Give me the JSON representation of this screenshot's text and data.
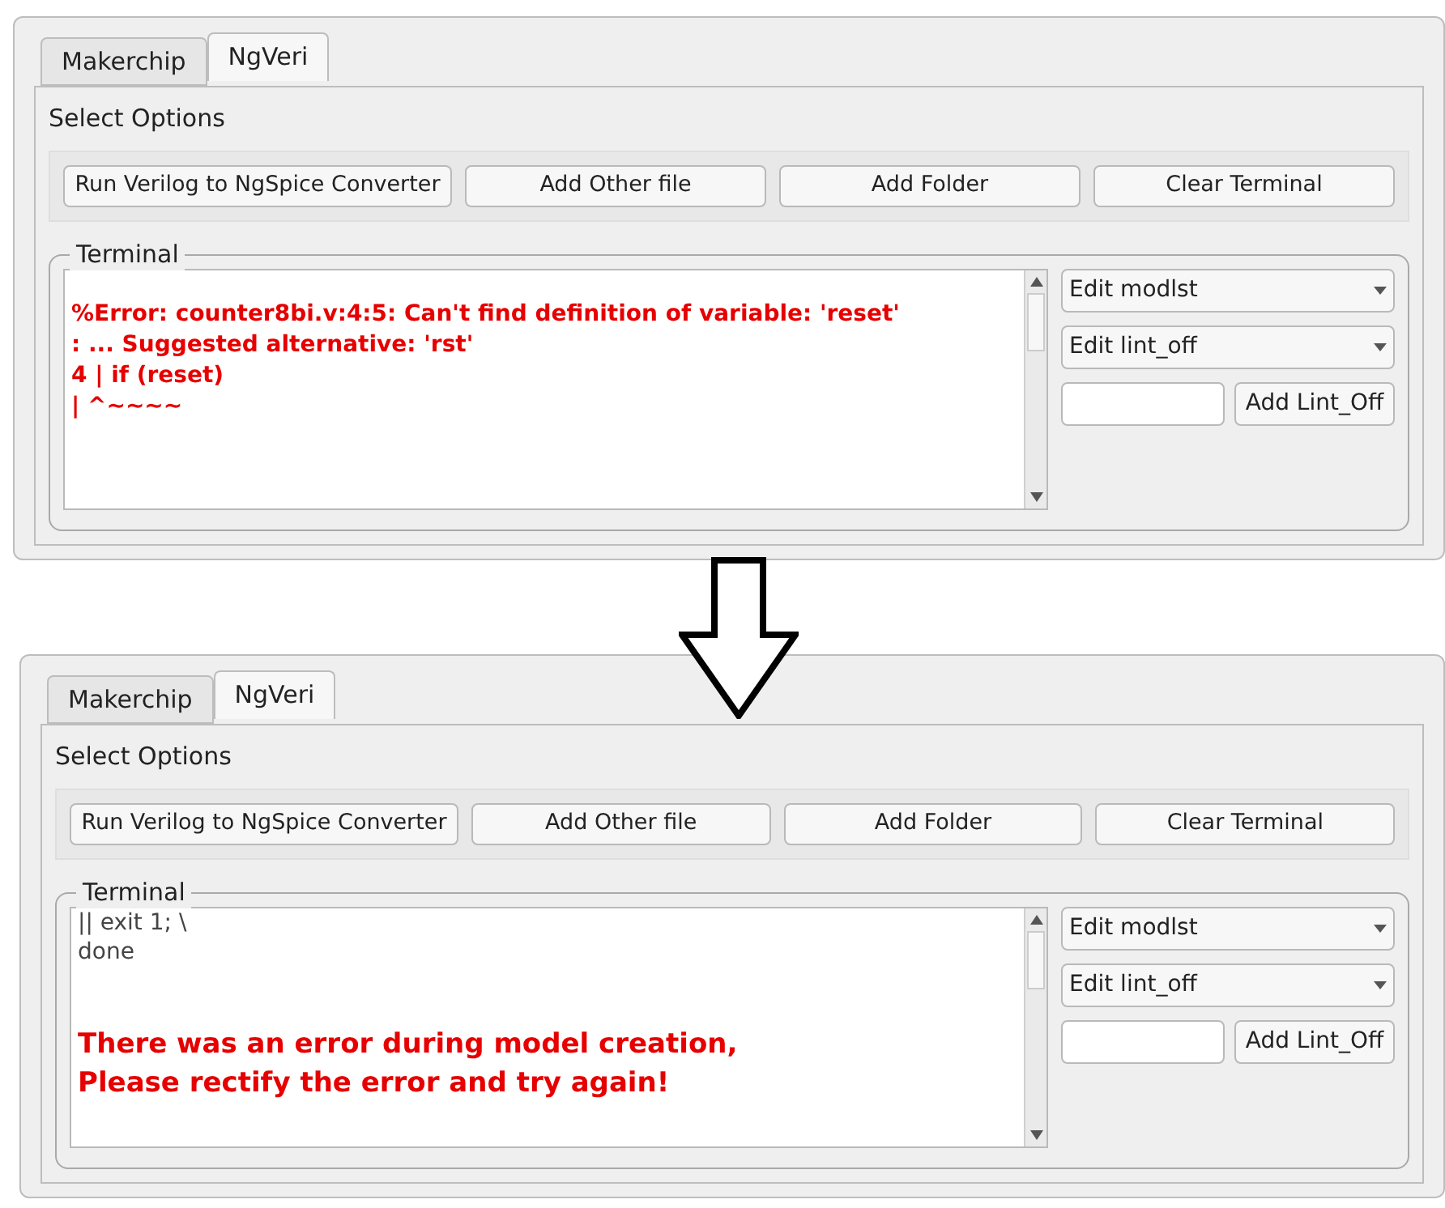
{
  "panels": [
    {
      "tabs": [
        {
          "label": "Makerchip",
          "selected": false
        },
        {
          "label": "NgVeri",
          "selected": true
        }
      ],
      "section_label": "Select Options",
      "buttons": [
        "Run Verilog to NgSpice Converter",
        "Add Other file",
        "Add Folder",
        "Clear Terminal"
      ],
      "terminal": {
        "legend": "Terminal",
        "lines": [
          {
            "kind": "blank"
          },
          {
            "kind": "error",
            "text": "%Error: counter8bi.v:4:5: Can't find definition of variable: 'reset'"
          },
          {
            "kind": "error",
            "text": ": ... Suggested alternative: 'rst'"
          },
          {
            "kind": "error",
            "text": "4 | if (reset)"
          },
          {
            "kind": "error",
            "text": "| ^~~~~"
          }
        ]
      },
      "dropdowns": [
        "Edit modlst",
        "Edit lint_off"
      ],
      "add_button": "Add Lint_Off"
    },
    {
      "tabs": [
        {
          "label": "Makerchip",
          "selected": false
        },
        {
          "label": "NgVeri",
          "selected": true
        }
      ],
      "section_label": "Select Options",
      "buttons": [
        "Run Verilog to NgSpice Converter",
        "Add Other file",
        "Add Folder",
        "Clear Terminal"
      ],
      "terminal": {
        "legend": "Terminal",
        "lines": [
          {
            "kind": "plain",
            "text": "|| exit 1; \\"
          },
          {
            "kind": "plain",
            "text": "done"
          },
          {
            "kind": "blank"
          },
          {
            "kind": "blank"
          },
          {
            "kind": "banner",
            "text": "There was an error during model creation,"
          },
          {
            "kind": "banner",
            "text": "Please rectify the error and try again!"
          }
        ]
      },
      "dropdowns": [
        "Edit modlst",
        "Edit lint_off"
      ],
      "add_button": "Add Lint_Off"
    }
  ]
}
